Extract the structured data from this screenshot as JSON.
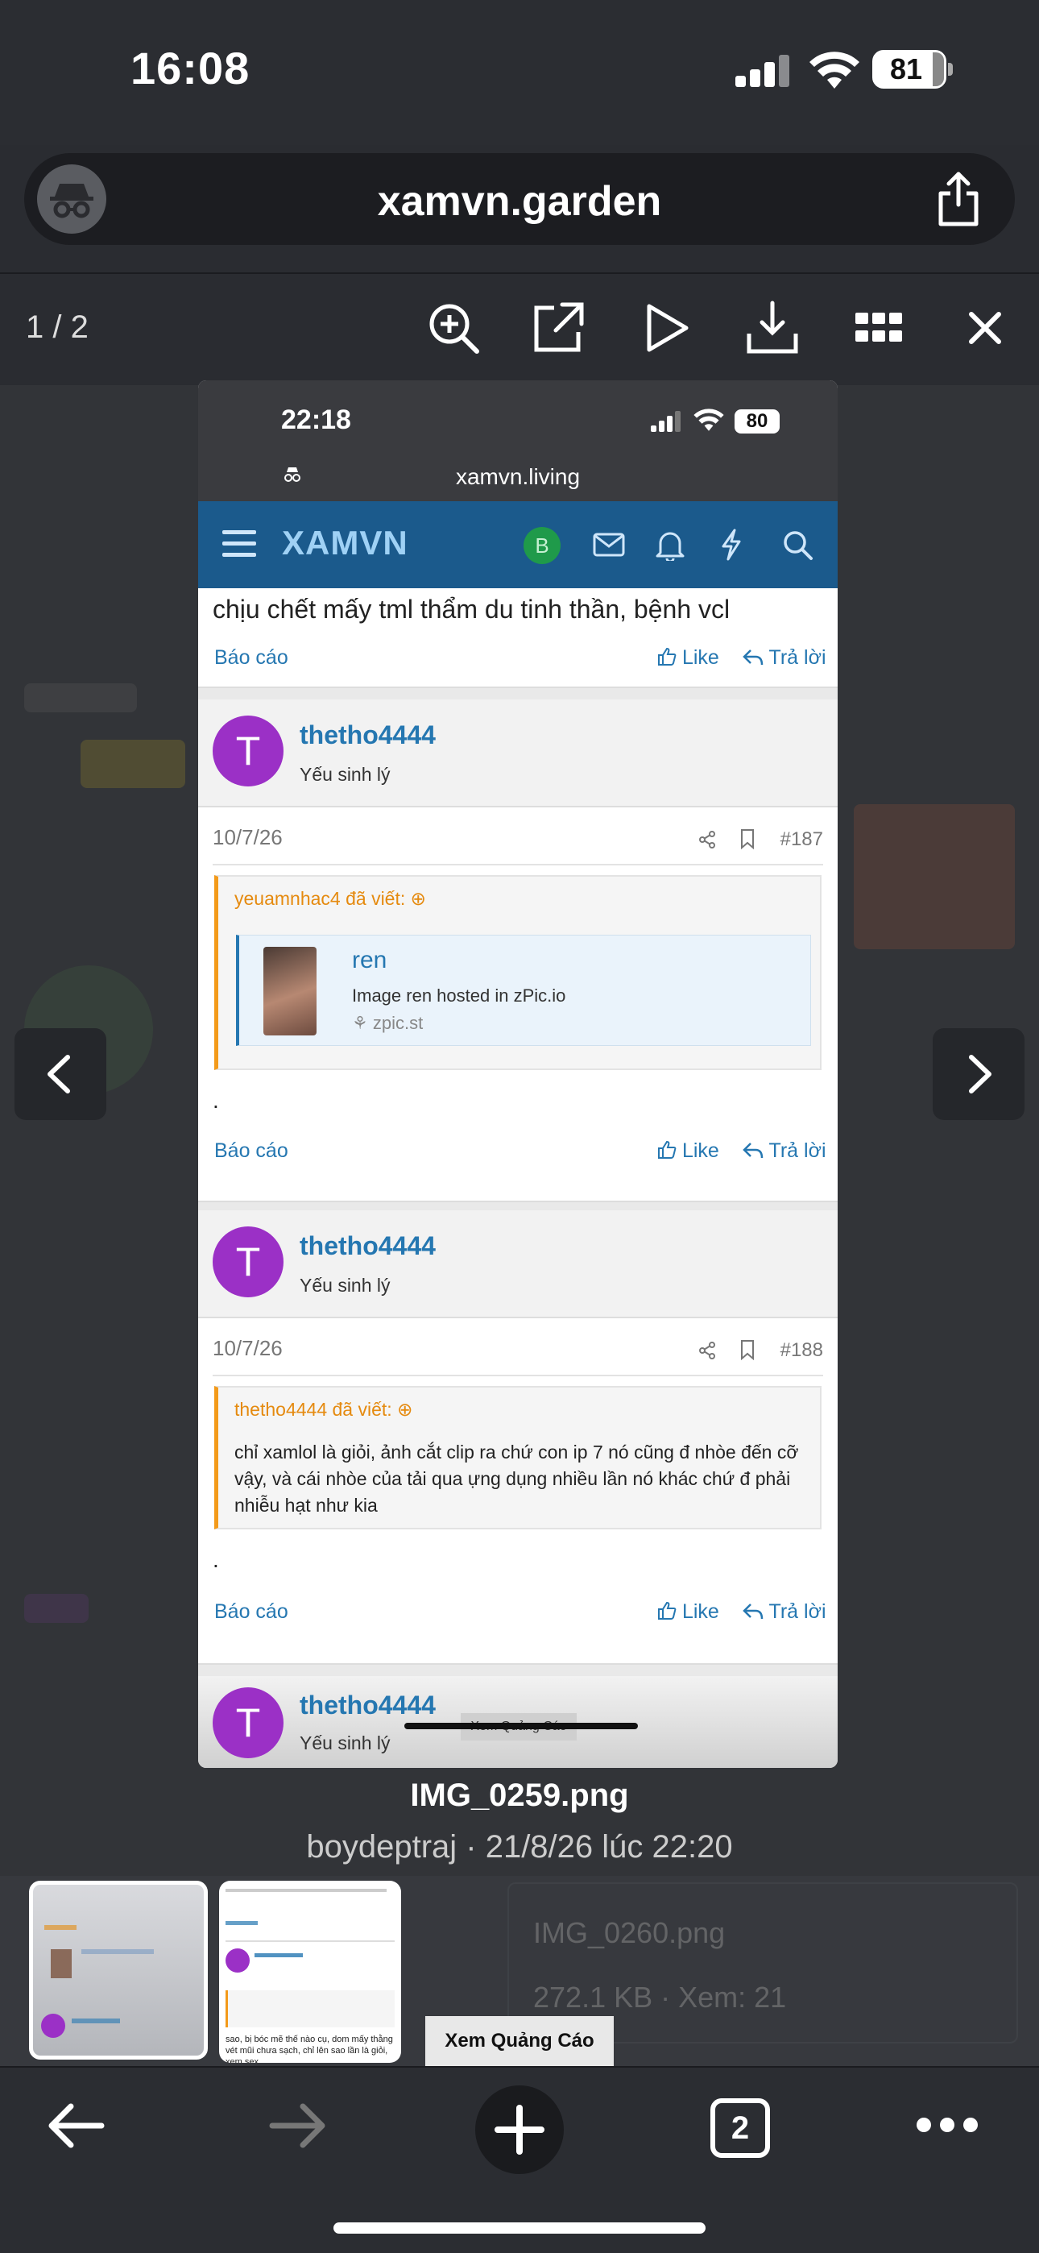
{
  "status_bar": {
    "time": "16:08",
    "battery": "81"
  },
  "address_bar": {
    "url": "xamvn.garden"
  },
  "viewer": {
    "counter": "1 / 2"
  },
  "inner": {
    "time": "22:18",
    "battery": "80",
    "url": "xamvn.living",
    "brand": "XAMVN",
    "badge": "B",
    "top_text": "chịu chết mấy tml thẩm du tinh thần, bệnh vcl",
    "report": "Báo cáo",
    "like": "Like",
    "reply": "Trả lời",
    "posts": [
      {
        "avatar": "T",
        "username": "thetho4444",
        "user_title": "Yếu sinh lý",
        "date": "10/7/26",
        "number": "#187",
        "quote_author": "yeuamnhac4 đã viết:",
        "embed_title": "ren",
        "embed_desc": "Image ren hosted in zPic.io",
        "embed_site": "zpic.st",
        "body": "."
      },
      {
        "avatar": "T",
        "username": "thetho4444",
        "user_title": "Yếu sinh lý",
        "date": "10/7/26",
        "number": "#188",
        "quote_author": "thetho4444 đã viết:",
        "quote_text": "chỉ xamlol là giỏi, ảnh cắt clip ra chứ con ip 7 nó cũng đ nhòe đến cỡ vậy, và cái nhòe của tải qua ựng dụng nhiều lần nó khác chứ đ phải nhiễu hạt như kia",
        "body": "."
      },
      {
        "avatar": "T",
        "username": "thetho4444",
        "user_title": "Yếu sinh lý"
      }
    ],
    "ad_overlay": "Xem Quảng Cáo"
  },
  "caption": {
    "filename": "IMG_0259.png",
    "meta": "boydeptraj · 21/8/26 lúc 22:20"
  },
  "background": {
    "file2_name": "IMG_0260.png",
    "file2_meta": "272.1 KB · Xem: 21"
  },
  "ad_button": "Xem Quảng Cáo",
  "tabs_count": "2",
  "thumb2_text": "sao, bị bóc mẽ thế nào cụ, dom mấy thằng vét mũi chưa sạch, chỉ lên sao lần là giỏi, xem sex"
}
